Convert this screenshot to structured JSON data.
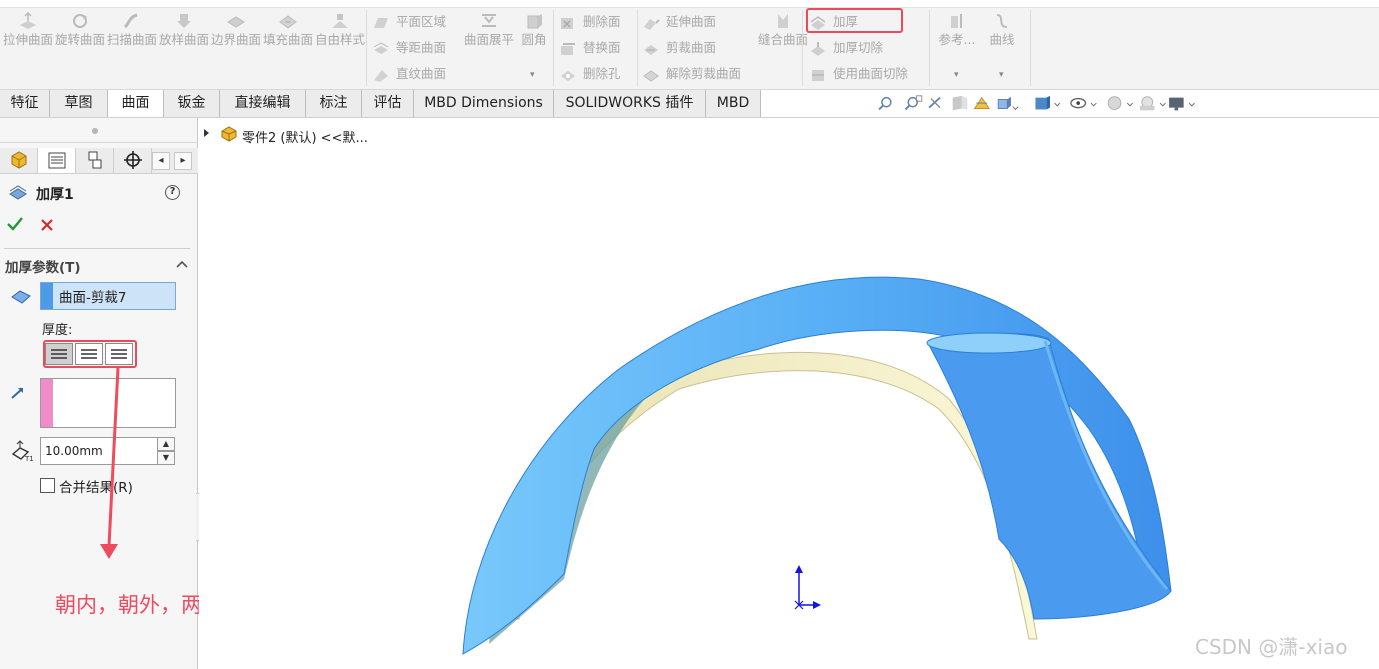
{
  "ribbon": {
    "large_buttons": [
      {
        "label": "拉伸曲面",
        "icon": "extruded-surface-icon"
      },
      {
        "label": "旋转曲面",
        "icon": "revolved-surface-icon"
      },
      {
        "label": "扫描曲面",
        "icon": "swept-surface-icon"
      },
      {
        "label": "放样曲面",
        "icon": "lofted-surface-icon"
      },
      {
        "label": "边界曲面",
        "icon": "boundary-surface-icon"
      },
      {
        "label": "填充曲面",
        "icon": "filled-surface-icon"
      },
      {
        "label": "自由样式",
        "icon": "freeform-icon"
      }
    ],
    "group1": [
      {
        "label": "平面区域",
        "icon": "planar-surface-icon"
      },
      {
        "label": "等距曲面",
        "icon": "offset-surface-icon"
      },
      {
        "label": "直纹曲面",
        "icon": "ruled-surface-icon"
      }
    ],
    "flatten": {
      "label": "曲面展平",
      "icon": "surface-flatten-icon"
    },
    "fillet": {
      "label": "圆角",
      "icon": "fillet-icon"
    },
    "group2": [
      {
        "label": "删除面",
        "icon": "delete-face-icon"
      },
      {
        "label": "替换面",
        "icon": "replace-face-icon"
      },
      {
        "label": "删除孔",
        "icon": "delete-hole-icon"
      }
    ],
    "group3": [
      {
        "label": "延伸曲面",
        "icon": "extend-surface-icon"
      },
      {
        "label": "剪裁曲面",
        "icon": "trim-surface-icon"
      },
      {
        "label": "解除剪裁曲面",
        "icon": "untrim-surface-icon"
      }
    ],
    "knit": {
      "label": "缝合曲面",
      "icon": "knit-surface-icon"
    },
    "group4": [
      {
        "label": "加厚",
        "icon": "thicken-icon"
      },
      {
        "label": "加厚切除",
        "icon": "thicken-cut-icon"
      },
      {
        "label": "使用曲面切除",
        "icon": "surface-cut-icon"
      }
    ],
    "reference": {
      "label": "参考...",
      "icon": "reference-geometry-icon"
    },
    "curves": {
      "label": "曲线",
      "icon": "curves-icon"
    }
  },
  "tabs": [
    "特征",
    "草图",
    "曲面",
    "钣金",
    "直接编辑",
    "标注",
    "评估",
    "MBD Dimensions",
    "SOLIDWORKS 插件",
    "MBD"
  ],
  "panel": {
    "feature_title": "加厚1",
    "section_title": "加厚参数(T)",
    "selected_surface": "曲面-剪裁7",
    "thickness_label": "厚度:",
    "thickness_value": "10.00mm",
    "merge_label": "合并结果(R)",
    "merge_checked": false,
    "help": "?"
  },
  "tree": {
    "root_text": "零件2 (默认) <<默..."
  },
  "annotation": {
    "text": "朝内，朝外，两侧加厚",
    "color": "#ef4b5f"
  },
  "watermark": "CSDN @潇-xiao",
  "colors": {
    "surface_blue": "#4aa8f5",
    "surface_cream": "#f8f4cf",
    "highlight_red": "#e84c5c"
  }
}
